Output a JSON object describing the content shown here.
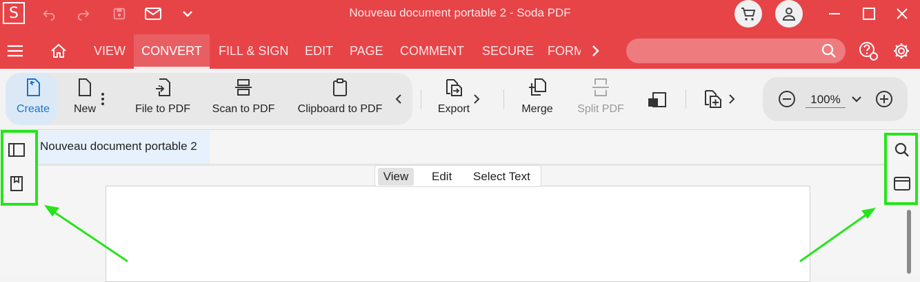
{
  "window": {
    "title": "Nouveau document portable 2   -   Soda PDF",
    "logo_letter": "S"
  },
  "menu": {
    "tabs": [
      "VIEW",
      "CONVERT",
      "FILL & SIGN",
      "EDIT",
      "PAGE",
      "COMMENT",
      "SECURE",
      "FORM"
    ],
    "active": "CONVERT"
  },
  "search": {
    "placeholder": ""
  },
  "toolbar": {
    "create": "Create",
    "new": "New",
    "file_to_pdf": "File to PDF",
    "scan_to_pdf": "Scan to PDF",
    "clipboard_to_pdf": "Clipboard to PDF",
    "export": "Export",
    "merge": "Merge",
    "split_pdf": "Split PDF"
  },
  "zoom": {
    "value": "100%"
  },
  "document": {
    "tab_title": "Nouveau document portable 2",
    "modes": [
      "View",
      "Edit",
      "Select Text"
    ],
    "active_mode": "View"
  },
  "colors": {
    "brand_red": "#e74448",
    "highlight_green": "#25e51a",
    "create_blue": "#1a73c7"
  }
}
